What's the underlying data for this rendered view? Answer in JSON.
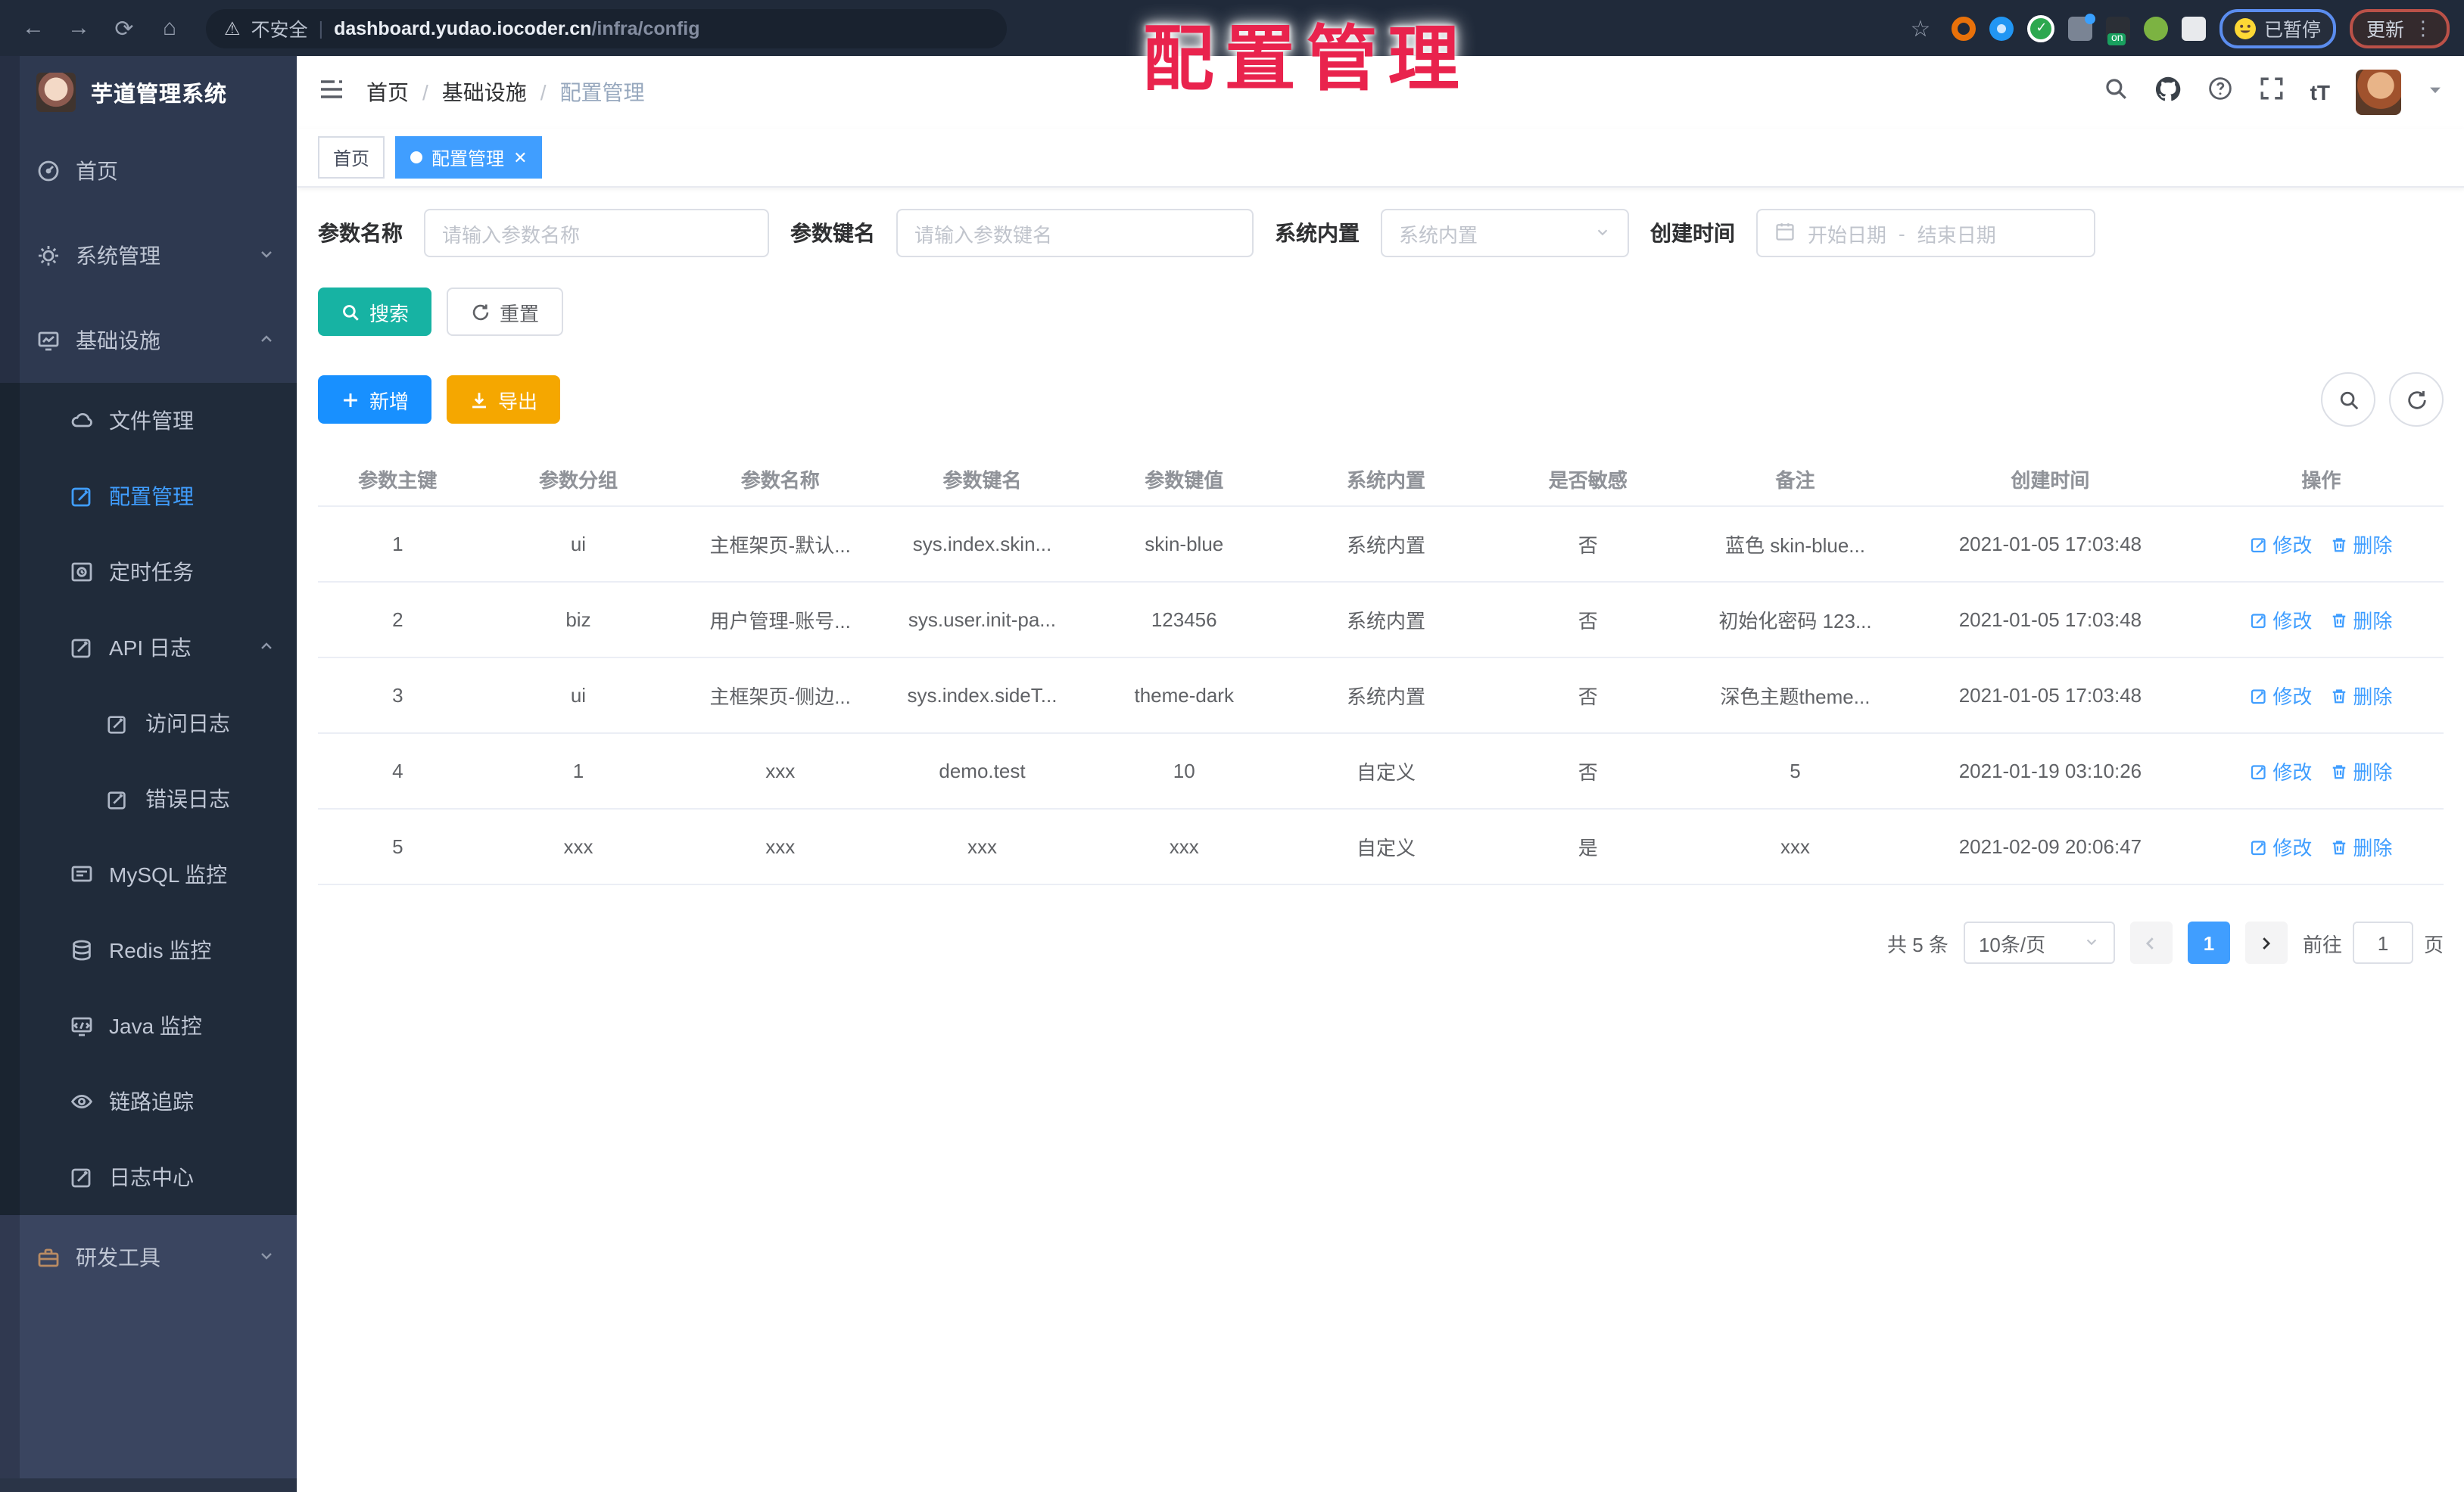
{
  "colors": {
    "accent": "#409eff",
    "add_blue": "#1890ff",
    "search_teal": "#17b3a3",
    "export_amber": "#f5a700",
    "annotation_red": "#e9234d",
    "sidebar_dark": "#2e3950",
    "submenu_dark": "#202b3a",
    "sidebar_light": "#3a4560"
  },
  "overlay_title": "配置管理",
  "browser": {
    "security_label": "不安全",
    "url_domain": "dashboard.yudao.iocoder.cn",
    "url_path": "/infra/config",
    "paused_badge": "已暂停",
    "update_button": "更新"
  },
  "sidebar": {
    "app_title": "芋道管理系统",
    "home": "首页",
    "system": "系统管理",
    "infra": "基础设施",
    "file": "文件管理",
    "config": "配置管理",
    "job": "定时任务",
    "api_log": "API 日志",
    "access_log": "访问日志",
    "error_log": "错误日志",
    "mysql": "MySQL 监控",
    "redis": "Redis 监控",
    "java": "Java 监控",
    "trace": "链路追踪",
    "log_center": "日志中心",
    "dev_tools": "研发工具"
  },
  "header": {
    "breadcrumb": [
      "首页",
      "基础设施",
      "配置管理"
    ]
  },
  "tags": [
    {
      "label": "首页",
      "active": false
    },
    {
      "label": "配置管理",
      "active": true
    }
  ],
  "filters": {
    "name_label": "参数名称",
    "name_placeholder": "请输入参数名称",
    "key_label": "参数键名",
    "key_placeholder": "请输入参数键名",
    "builtin_label": "系统内置",
    "builtin_placeholder": "系统内置",
    "date_label": "创建时间",
    "date_start": "开始日期",
    "date_separator": "-",
    "date_end": "结束日期"
  },
  "actions": {
    "search": "搜索",
    "reset": "重置",
    "add": "新增",
    "export": "导出"
  },
  "table": {
    "columns": [
      "参数主键",
      "参数分组",
      "参数名称",
      "参数键名",
      "参数键值",
      "系统内置",
      "是否敏感",
      "备注",
      "创建时间",
      "操作"
    ],
    "rows": [
      {
        "id": "1",
        "group": "ui",
        "name": "主框架页-默认...",
        "key": "sys.index.skin...",
        "value": "skin-blue",
        "builtin": "系统内置",
        "sensitive": "否",
        "remark": "蓝色 skin-blue...",
        "time": "2021-01-05 17:03:48"
      },
      {
        "id": "2",
        "group": "biz",
        "name": "用户管理-账号...",
        "key": "sys.user.init-pa...",
        "value": "123456",
        "builtin": "系统内置",
        "sensitive": "否",
        "remark": "初始化密码 123...",
        "time": "2021-01-05 17:03:48"
      },
      {
        "id": "3",
        "group": "ui",
        "name": "主框架页-侧边...",
        "key": "sys.index.sideT...",
        "value": "theme-dark",
        "builtin": "系统内置",
        "sensitive": "否",
        "remark": "深色主题theme...",
        "time": "2021-01-05 17:03:48"
      },
      {
        "id": "4",
        "group": "1",
        "name": "xxx",
        "key": "demo.test",
        "value": "10",
        "builtin": "自定义",
        "sensitive": "否",
        "remark": "5",
        "time": "2021-01-19 03:10:26"
      },
      {
        "id": "5",
        "group": "xxx",
        "name": "xxx",
        "key": "xxx",
        "value": "xxx",
        "builtin": "自定义",
        "sensitive": "是",
        "remark": "xxx",
        "time": "2021-02-09 20:06:47"
      }
    ],
    "edit_label": "修改",
    "delete_label": "删除"
  },
  "pagination": {
    "total": "共 5 条",
    "page_size": "10条/页",
    "current_page": "1",
    "goto_prefix": "前往",
    "goto_value": "1",
    "goto_suffix": "页"
  }
}
